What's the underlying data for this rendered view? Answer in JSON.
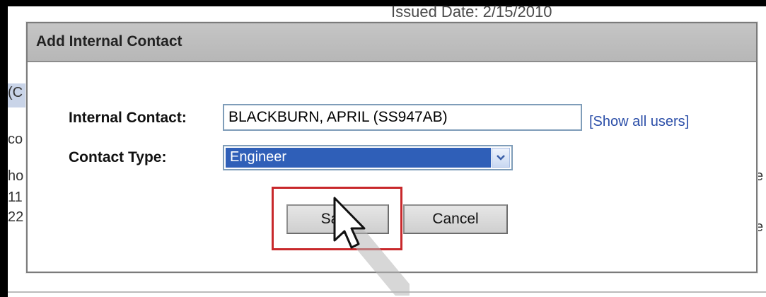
{
  "background": {
    "issued_date_text": "Issued Date: 2/15/2010",
    "left_fragments": [
      "(C",
      "co",
      "ho",
      "11",
      "22"
    ],
    "right_fragments": [
      "e",
      "e"
    ]
  },
  "dialog": {
    "title": "Add Internal Contact",
    "internal_contact": {
      "label": "Internal Contact:",
      "value": "BLACKBURN, APRIL (SS947AB)",
      "show_all_users_link": "[Show all users]"
    },
    "contact_type": {
      "label": "Contact Type:",
      "selected": "Engineer"
    },
    "buttons": {
      "save_label": "Save",
      "cancel_label": "Cancel"
    }
  },
  "colors": {
    "title_bar": "#c0c0c0",
    "selected_option_bg": "#2f5fb8",
    "link": "#2b4ea8",
    "highlight_border": "#c8282b"
  },
  "icons": {
    "dropdown": "chevron-down-icon",
    "cursor": "hand-pointer-cursor-icon"
  }
}
